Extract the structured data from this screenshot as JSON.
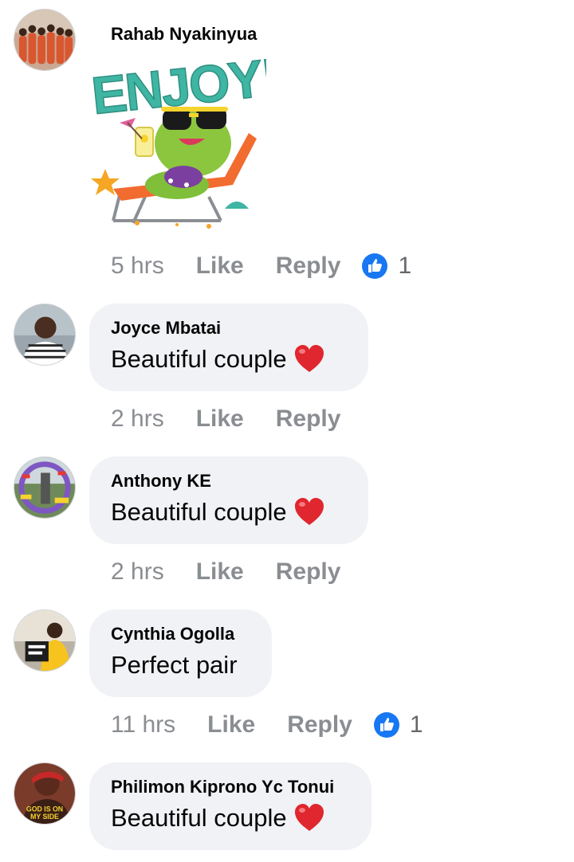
{
  "comments": [
    {
      "name": "Rahab Nyakinyua",
      "sticker_text": "ENJOY!",
      "time": "5 hrs",
      "like": "Like",
      "reply": "Reply",
      "reactions": "1"
    },
    {
      "name": "Joyce Mbatai",
      "text": "Beautiful couple",
      "time": "2 hrs",
      "like": "Like",
      "reply": "Reply"
    },
    {
      "name": "Anthony KE",
      "text": "Beautiful couple",
      "time": "2 hrs",
      "like": "Like",
      "reply": "Reply"
    },
    {
      "name": "Cynthia Ogolla",
      "text": "Perfect pair",
      "time": "11 hrs",
      "like": "Like",
      "reply": "Reply",
      "reactions": "1"
    },
    {
      "name": "Philimon Kiprono Yc Tonui",
      "text": "Beautiful couple",
      "avatar_caption": "GOD IS ON MY SIDE"
    }
  ],
  "colors": {
    "bubble": "#f0f2f5",
    "meta_text": "#8a8d91",
    "like_blue": "#1877f2",
    "heart_red": "#e0262e",
    "sticker_teal": "#3fb5a3"
  }
}
